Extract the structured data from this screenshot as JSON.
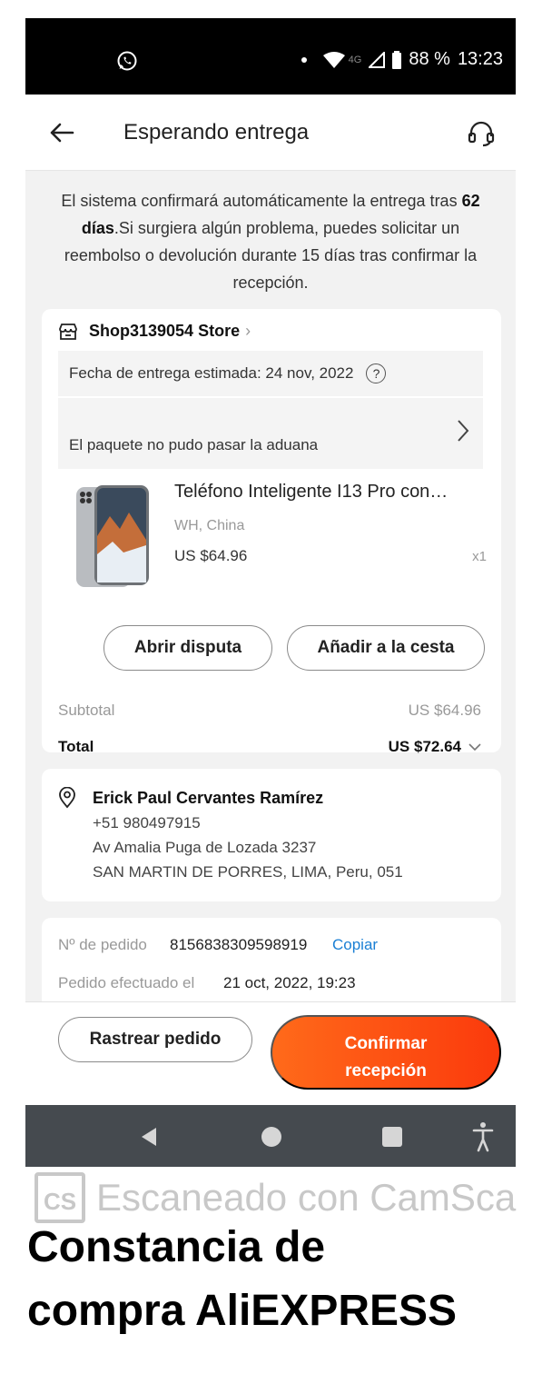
{
  "status_bar": {
    "battery": "88 %",
    "time": "13:23",
    "network": "4G",
    "icons": [
      "whatsapp-icon",
      "dot-icon",
      "wifi-icon",
      "signal-icon",
      "battery-icon"
    ]
  },
  "header": {
    "title": "Esperando entrega",
    "icons": [
      "back-arrow-icon",
      "headset-icon"
    ]
  },
  "notice": {
    "before": "El sistema confirmará automáticamente la entrega tras ",
    "bold": "62 días",
    "after": ".Si surgiera algún problema, puedes solicitar un reembolso o devolución durante 15 días tras confirmar la recepción."
  },
  "order": {
    "store_name": "Shop3139054 Store",
    "estimated_delivery": "Fecha de entrega estimada: 24 nov, 2022",
    "customs_status": "El paquete no pudo pasar la aduana",
    "product": {
      "title": "Teléfono Inteligente I13 Pro con…",
      "origin": "WH, China",
      "price": "US $64.96",
      "quantity": "x1"
    },
    "buttons": {
      "dispute": "Abrir disputa",
      "add_to_cart": "Añadir a la cesta"
    },
    "subtotal_label": "Subtotal",
    "subtotal_value": "US $64.96",
    "total_label": "Total",
    "total_value": "US $72.64"
  },
  "address": {
    "name": "Erick Paul Cervantes Ramírez",
    "phone": "+51 980497915",
    "street": "Av Amalia Puga de Lozada 3237",
    "city": "SAN MARTIN DE PORRES, LIMA, Peru, 051"
  },
  "order_info": {
    "order_no_label": "Nº de pedido",
    "order_no": "8156838309598919",
    "copy_label": "Copiar",
    "placed_label": "Pedido efectuado el",
    "placed_date": "21 oct, 2022, 19:23"
  },
  "actions": {
    "track": "Rastrear pedido",
    "confirm_line1": "Confirmar",
    "confirm_line2": "recepción"
  },
  "nav_bar": {
    "icons": [
      "nav-back-icon",
      "nav-home-icon",
      "nav-recents-icon",
      "accessibility-icon"
    ]
  },
  "watermark": {
    "logo": "CS",
    "text": "Escaneado con CamSca"
  },
  "caption": {
    "line1": "Constancia de",
    "line2": "compra AliEXPRESS"
  },
  "colors": {
    "accent_orange": "#ff5a14",
    "link_blue": "#1a7fd4",
    "status_bar": "#000000",
    "nav_bar": "#454a4f"
  }
}
